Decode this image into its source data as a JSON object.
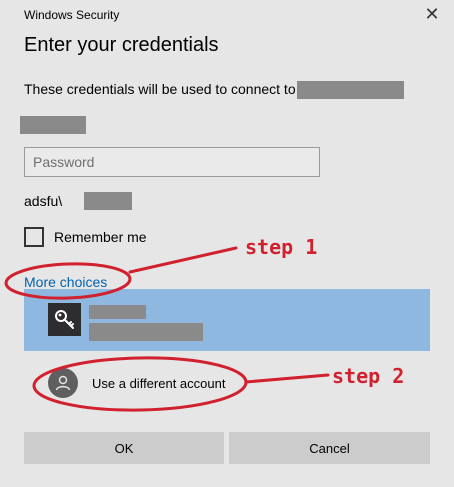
{
  "window": {
    "title": "Windows Security",
    "close_glyph": "✕"
  },
  "dialog": {
    "heading": "Enter your credentials",
    "description": "These credentials will be used to connect to"
  },
  "password": {
    "placeholder": "Password",
    "value": ""
  },
  "username": {
    "prefix": "adsfu\\"
  },
  "remember": {
    "label": "Remember me",
    "checked": false
  },
  "more_choices": {
    "label": "More choices"
  },
  "account_list": {
    "selected_color": "#8fb8e0",
    "items": [
      {
        "type": "stored-credential",
        "icon": "key-icon"
      },
      {
        "type": "different-account",
        "icon": "person-icon",
        "label": "Use a different account"
      }
    ]
  },
  "buttons": {
    "ok": "OK",
    "cancel": "Cancel"
  },
  "annotations": {
    "step1": "step 1",
    "step2": "step 2",
    "color": "#d1202e"
  }
}
